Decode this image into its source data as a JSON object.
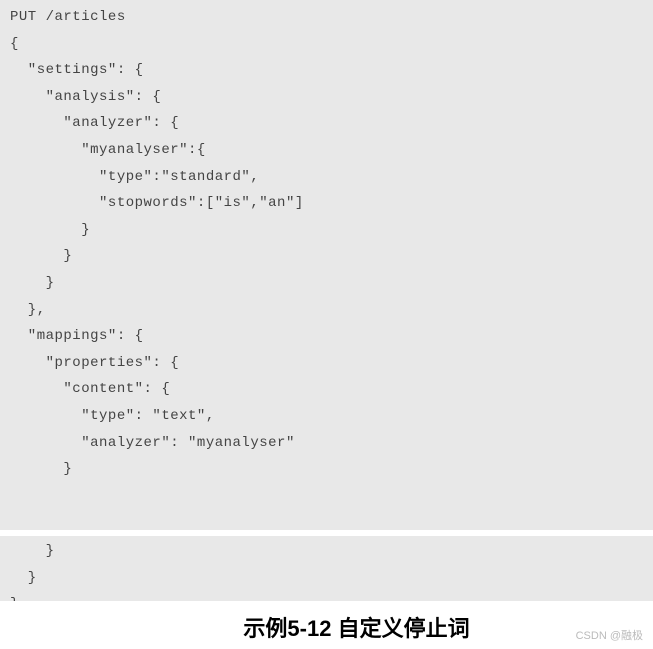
{
  "code": {
    "block1": [
      "PUT /articles",
      "{",
      "  \"settings\": {",
      "    \"analysis\": {",
      "      \"analyzer\": {",
      "        \"myanalyser\":{",
      "          \"type\":\"standard\",",
      "          \"stopwords\":[\"is\",\"an\"]",
      "        }",
      "      }",
      "    }",
      "  },",
      "  \"mappings\": {",
      "    \"properties\": {",
      "      \"content\": {",
      "        \"type\": \"text\",",
      "        \"analyzer\": \"myanalyser\"",
      "      }"
    ],
    "block2": [
      "    }",
      "  }",
      "}"
    ]
  },
  "caption": "示例5-12 自定义停止词",
  "watermark": "CSDN @融极"
}
